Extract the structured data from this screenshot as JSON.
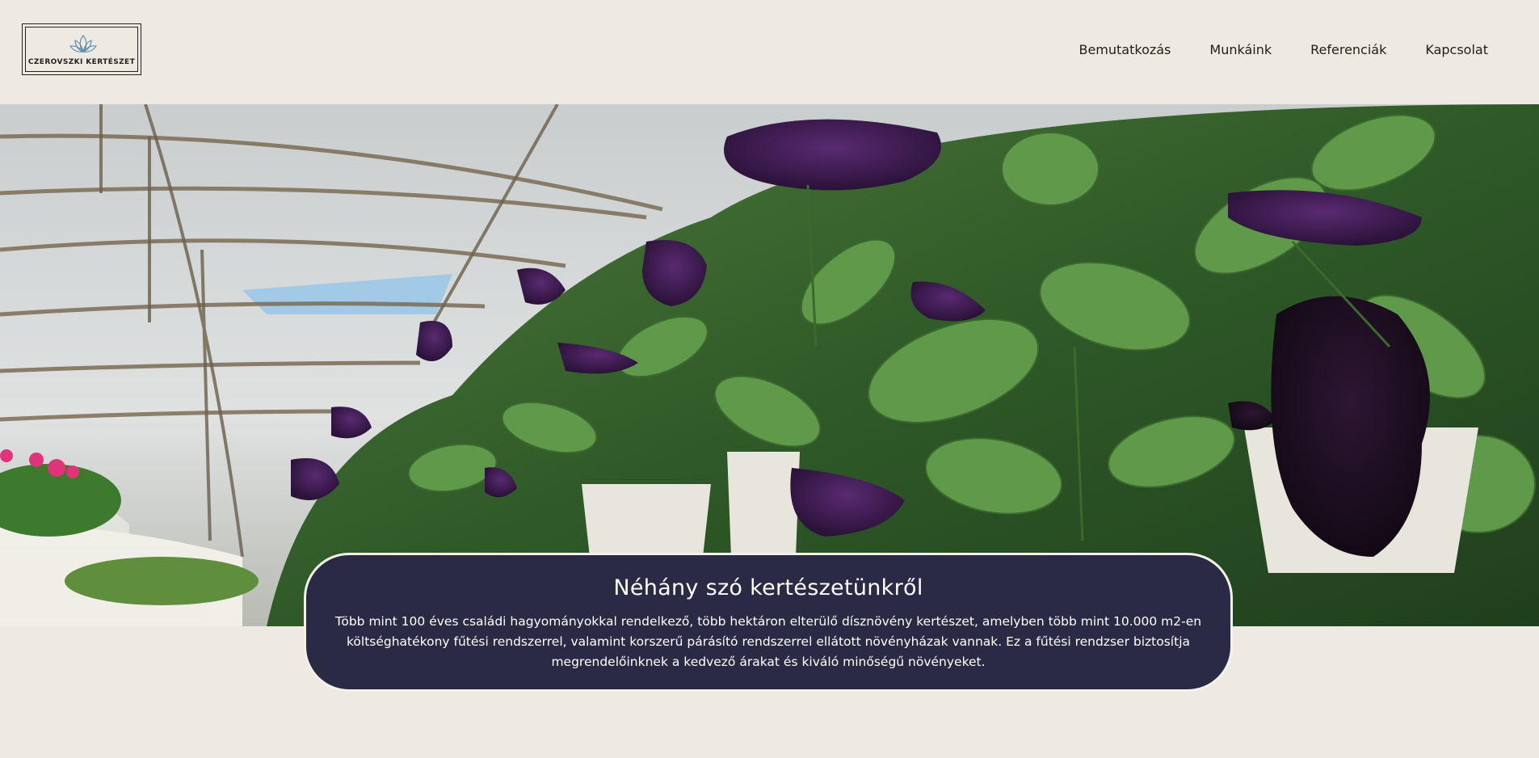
{
  "logo": {
    "text": "CZEROVSZKI KERTÉSZET",
    "icon": "lotus-icon",
    "icon_color": "#5b8fb0"
  },
  "nav": {
    "items": [
      {
        "label": "Bemutatkozás"
      },
      {
        "label": "Munkáink"
      },
      {
        "label": "Referenciák"
      },
      {
        "label": "Kapcsolat"
      }
    ]
  },
  "hero": {
    "image": "greenhouse-petunias-photo"
  },
  "about": {
    "title": "Néhány szó kertészetünkről",
    "text": "Több mint 100 éves családi hagyományokkal rendelkező, több hektáron elterülő dísznövény kertészet, amelyben több mint 10.000 m2-en költséghatékony fűtési rendszerrel, valamint korszerű párásító rendszerrel ellátott növényházak vannak. Ez a fűtési rendzser biztosítja megrendelőinknek a kedvező árakat és kiváló minőségű növényeket."
  },
  "colors": {
    "background": "#eeeae1",
    "about_box": "#2b2a45",
    "text_dark": "#1e1e1e"
  }
}
